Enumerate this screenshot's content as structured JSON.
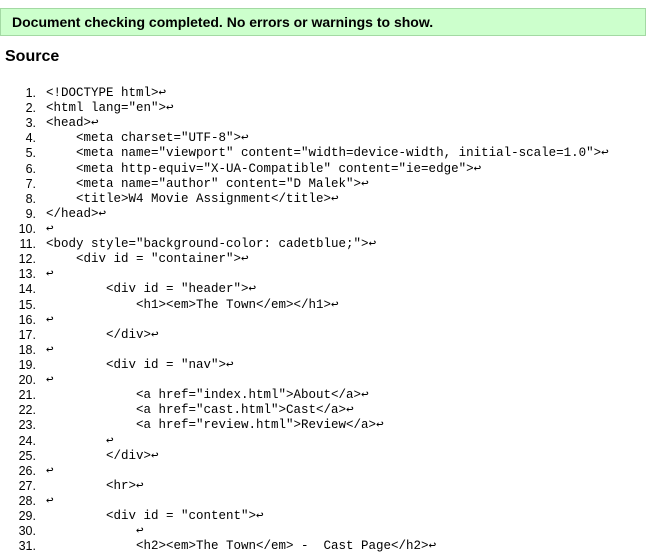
{
  "status": {
    "message": "Document checking completed. No errors or warnings to show."
  },
  "source": {
    "heading": "Source",
    "line_end_marker": "↩",
    "lines": [
      {
        "number": "1.",
        "code": "<!DOCTYPE html>"
      },
      {
        "number": "2.",
        "code": "<html lang=\"en\">"
      },
      {
        "number": "3.",
        "code": "<head>"
      },
      {
        "number": "4.",
        "code": "    <meta charset=\"UTF-8\">"
      },
      {
        "number": "5.",
        "code": "    <meta name=\"viewport\" content=\"width=device-width, initial-scale=1.0\">"
      },
      {
        "number": "6.",
        "code": "    <meta http-equiv=\"X-UA-Compatible\" content=\"ie=edge\">"
      },
      {
        "number": "7.",
        "code": "    <meta name=\"author\" content=\"D Malek\">"
      },
      {
        "number": "8.",
        "code": "    <title>W4 Movie Assignment</title>"
      },
      {
        "number": "9.",
        "code": "</head>"
      },
      {
        "number": "10.",
        "code": ""
      },
      {
        "number": "11.",
        "code": "<body style=\"background-color: cadetblue;\">"
      },
      {
        "number": "12.",
        "code": "    <div id = \"container\">"
      },
      {
        "number": "13.",
        "code": ""
      },
      {
        "number": "14.",
        "code": "        <div id = \"header\">"
      },
      {
        "number": "15.",
        "code": "            <h1><em>The Town</em></h1>"
      },
      {
        "number": "16.",
        "code": ""
      },
      {
        "number": "17.",
        "code": "        </div>"
      },
      {
        "number": "18.",
        "code": ""
      },
      {
        "number": "19.",
        "code": "        <div id = \"nav\">"
      },
      {
        "number": "20.",
        "code": ""
      },
      {
        "number": "21.",
        "code": "            <a href=\"index.html\">About</a>"
      },
      {
        "number": "22.",
        "code": "            <a href=\"cast.html\">Cast</a>"
      },
      {
        "number": "23.",
        "code": "            <a href=\"review.html\">Review</a>"
      },
      {
        "number": "24.",
        "code": "        "
      },
      {
        "number": "25.",
        "code": "        </div>"
      },
      {
        "number": "26.",
        "code": ""
      },
      {
        "number": "27.",
        "code": "        <hr>"
      },
      {
        "number": "28.",
        "code": ""
      },
      {
        "number": "29.",
        "code": "        <div id = \"content\">"
      },
      {
        "number": "30.",
        "code": "            "
      },
      {
        "number": "31.",
        "code": "            <h2><em>The Town</em> -  Cast Page</h2>"
      }
    ]
  }
}
